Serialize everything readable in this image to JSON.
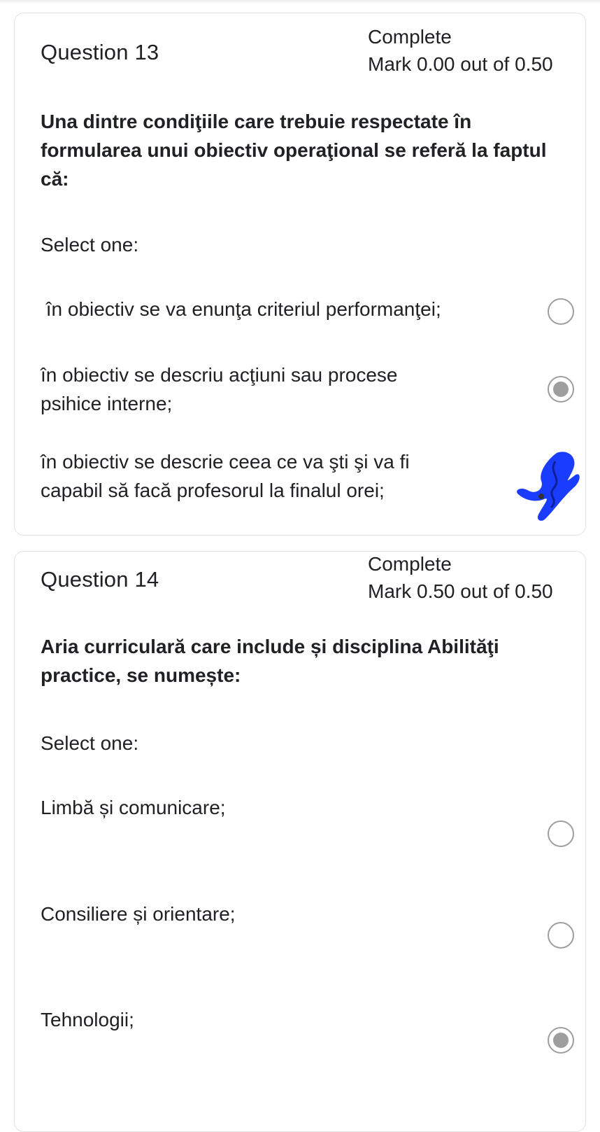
{
  "questions": [
    {
      "title": "Question 13",
      "state": "Complete",
      "mark": "Mark 0.00 out of 0.50",
      "text": "Una dintre condiţiile care trebuie respectate în formularea unui obiectiv operaţional se referă la faptul că:",
      "prompt": "Select one:",
      "options": [
        {
          "label": " în obiectiv se va enunţa criteriul performanţei;",
          "selected": false
        },
        {
          "label": "în  obiectiv se descriu acţiuni sau procese psihice interne;",
          "selected": true
        },
        {
          "label": "în obiectiv se descrie ceea ce va şti şi va fi capabil să facă profesorul la finalul orei;",
          "selected": false,
          "annotation": "blue-scribble"
        }
      ]
    },
    {
      "title": "Question 14",
      "state": "Complete",
      "mark": "Mark 0.50 out of 0.50",
      "text": "Aria curriculară care include și disciplina Abilităţi practice, se numește:",
      "prompt": "Select one:",
      "options": [
        {
          "label": "Limbă și comunicare;",
          "selected": false
        },
        {
          "label": "Consiliere și orientare;",
          "selected": false
        },
        {
          "label": "Tehnologii;",
          "selected": true
        }
      ]
    }
  ],
  "colors": {
    "radio": "#9e9e9e",
    "card_border": "#e2e2e2",
    "scribble": "#1a3cff"
  }
}
